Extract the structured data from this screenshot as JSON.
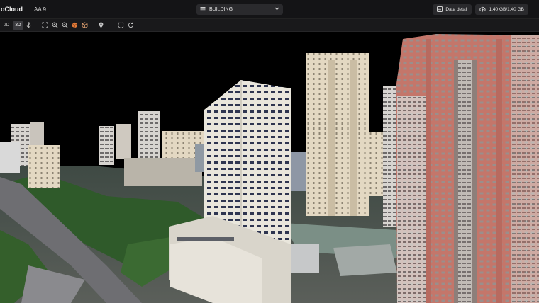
{
  "header": {
    "brand": "oCloud",
    "project": "AA 9",
    "layer_select": {
      "label": "BUILDING",
      "icon": "layers-icon",
      "chevron": "chevron-down-icon"
    },
    "data_detail_label": "Data detail",
    "storage_label": "1.40 GB/1.40 GB"
  },
  "toolbar": {
    "mode_2d": "2D",
    "mode_3d": "3D",
    "active_mode": "3D",
    "tools": [
      "anchor-icon",
      "fit-view-icon",
      "zoom-in-icon",
      "zoom-out-icon",
      "cube-orange-icon",
      "cube-outline-icon",
      "location-pin-icon",
      "line-measure-icon",
      "area-measure-icon",
      "reset-icon"
    ]
  },
  "viewport": {
    "content": "3D photogrammetry model of city buildings"
  },
  "colors": {
    "app_bg": "#0b0b0c",
    "topbar_bg": "#141416",
    "pill_bg": "#2a2a2d",
    "accent_orange": "#e07a3a"
  }
}
